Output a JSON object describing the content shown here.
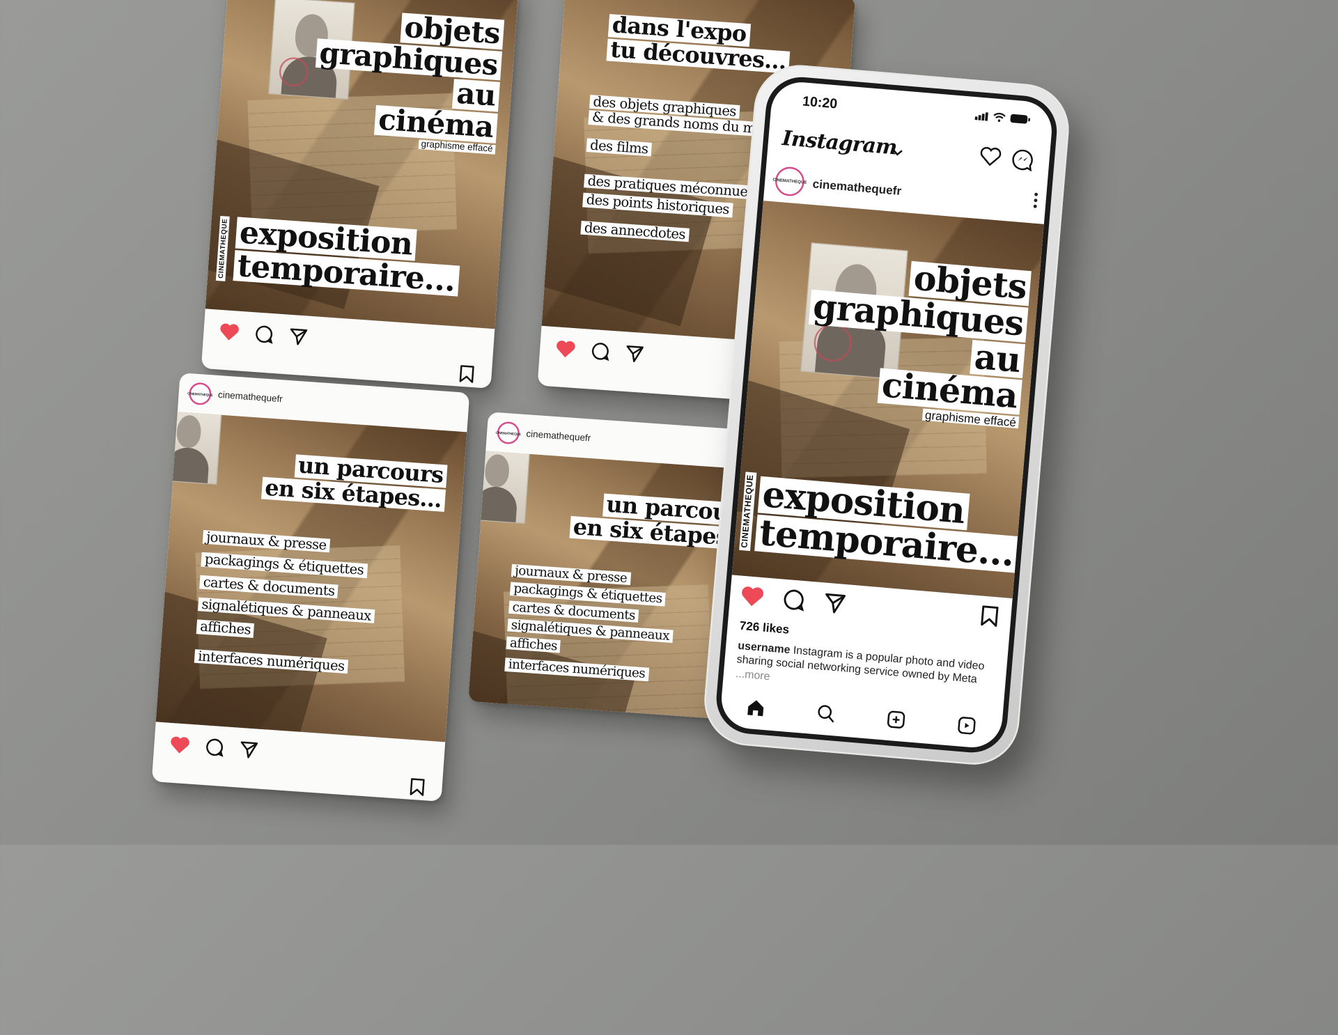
{
  "username": "cinemathequefr",
  "avatar_text": "CINEMATHEQUE",
  "side_tag": "CINEMATHEQUE",
  "card1": {
    "title_lines": [
      "objets",
      "graphiques",
      "au",
      "cinéma"
    ],
    "subtitle": "graphisme effacé",
    "footer_lines": [
      "exposition",
      "temporaire..."
    ]
  },
  "card2": {
    "title_lines": [
      "dans l'expo",
      "tu découvres..."
    ],
    "items": [
      "des objets graphiques",
      "& des grands noms du métier",
      "des films",
      "des pratiques méconnues",
      "des points historiques",
      "des annecdotes"
    ]
  },
  "card3": {
    "title_lines": [
      "un parcours",
      "en six étapes..."
    ],
    "items": [
      "journaux & presse",
      "packagings & étiquettes",
      "cartes & documents",
      "signalétiques & panneaux",
      "affiches",
      "interfaces numériques"
    ]
  },
  "phone": {
    "time": "10:20",
    "app_name": "Instagram",
    "likes": "726 likes",
    "caption_user": "username",
    "caption_text": "Instagram is a popular photo and video sharing social networking service owned by Meta",
    "more": "...more"
  },
  "colors": {
    "like": "#ed4956",
    "ink": "#111111",
    "avatar_ring": "#d64b8b"
  },
  "icons": [
    "heart-icon",
    "comment-icon",
    "share-icon",
    "bookmark-icon",
    "home-icon",
    "search-icon",
    "add-icon",
    "messenger-icon",
    "chevron-down-icon"
  ]
}
